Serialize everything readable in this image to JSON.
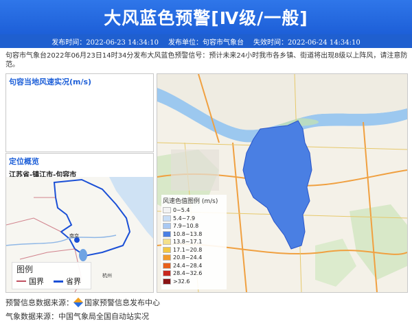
{
  "header": {
    "title": "大风蓝色预警[Ⅳ级/一般]"
  },
  "meta": {
    "publish_time": "发布时间：2022-06-23 14:34:10",
    "publisher": "发布单位：句容市气象台",
    "expire_time": "失效时间：2022-06-24 14:34:10"
  },
  "description": "句容市气象台2022年06月23日14时34分发布大风蓝色预警信号：预计未来24小时我市各乡镇、街道将出现8级以上阵风，请注意防范。",
  "wind_panel": {
    "title": "句容当地风速实况(m/s)"
  },
  "location_panel": {
    "title": "定位概览",
    "path": "江苏省-镇江市-句容市",
    "map_labels": {
      "nanjing": "南京",
      "hangzhou": "杭州"
    },
    "legend": {
      "title": "图例",
      "national": "国界",
      "provincial": "省界"
    }
  },
  "map": {
    "legend_title": "风速色值图例 (m/s)",
    "legend_items": [
      {
        "label": "0~5.4",
        "color": "#f3f3f3"
      },
      {
        "label": "5.4~7.9",
        "color": "#c9def6"
      },
      {
        "label": "7.9~10.8",
        "color": "#a9c8f2"
      },
      {
        "label": "10.8~13.8",
        "color": "#4a7fe3"
      },
      {
        "label": "13.8~17.1",
        "color": "#f4e08a"
      },
      {
        "label": "17.1~20.8",
        "color": "#f2c744"
      },
      {
        "label": "20.8~24.4",
        "color": "#f29b2c"
      },
      {
        "label": "24.4~28.4",
        "color": "#e8601c"
      },
      {
        "label": "28.4~32.6",
        "color": "#c8281e"
      },
      {
        "label": ">32.6",
        "color": "#8a1414"
      }
    ],
    "region_color": "#4a7fe3"
  },
  "footer": {
    "warning_source_label": "预警信息数据来源：",
    "warning_source": "国家预警信息发布中心",
    "weather_source_label": "气象数据来源：",
    "weather_source": "中国气象局全国自动站实况"
  }
}
